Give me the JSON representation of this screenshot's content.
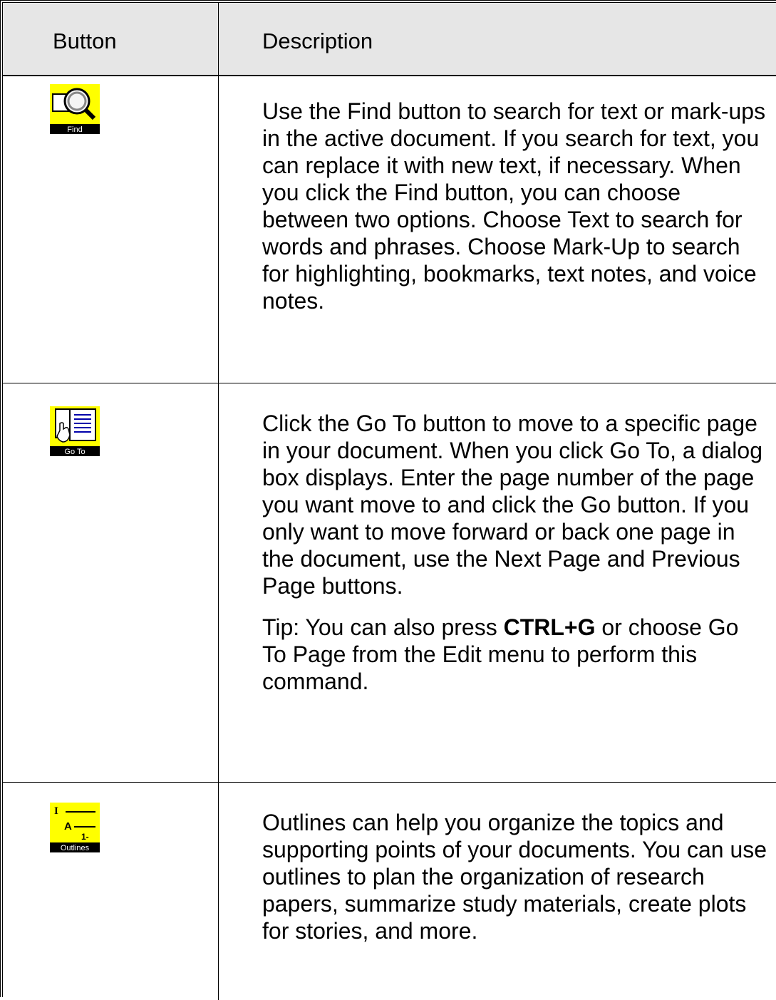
{
  "table": {
    "headers": {
      "button": "Button",
      "description": "Description"
    },
    "rows": [
      {
        "icon_name": "find-icon",
        "icon_label": "Find",
        "description": "Use the Find button to search for text or mark-ups in the active document. If you search for text, you can replace it with new text, if necessary. When you click the Find button, you can choose between two options. Choose Text to search for words and phrases. Choose Mark-Up to search for highlighting, bookmarks, text notes, and voice notes."
      },
      {
        "icon_name": "go-to-icon",
        "icon_label": "Go To",
        "description": "Click the Go To button to move to a specific page in your document. When you click Go To, a dialog box displays. Enter the page number of the page you want move to and click the Go button. If you only want to move forward or back one page in the document, use the Next Page and Previous Page buttons.",
        "tip_prefix": "Tip: You can also press ",
        "tip_key": "CTRL+G",
        "tip_suffix": " or choose Go To Page from the Edit menu to perform this command."
      },
      {
        "icon_name": "outlines-icon",
        "icon_label": "Outlines",
        "icon_glyphs": [
          "I",
          "A",
          "1-"
        ],
        "description": "Outlines can help you organize the topics and supporting points of your documents. You can use outlines to plan the organization of research papers, summarize study materials, create plots for stories, and more."
      }
    ]
  },
  "colors": {
    "header_bg": "#e6e6e6",
    "icon_yellow": "#ffff00",
    "icon_label_bg": "#000000",
    "icon_label_fg": "#ffffff"
  }
}
